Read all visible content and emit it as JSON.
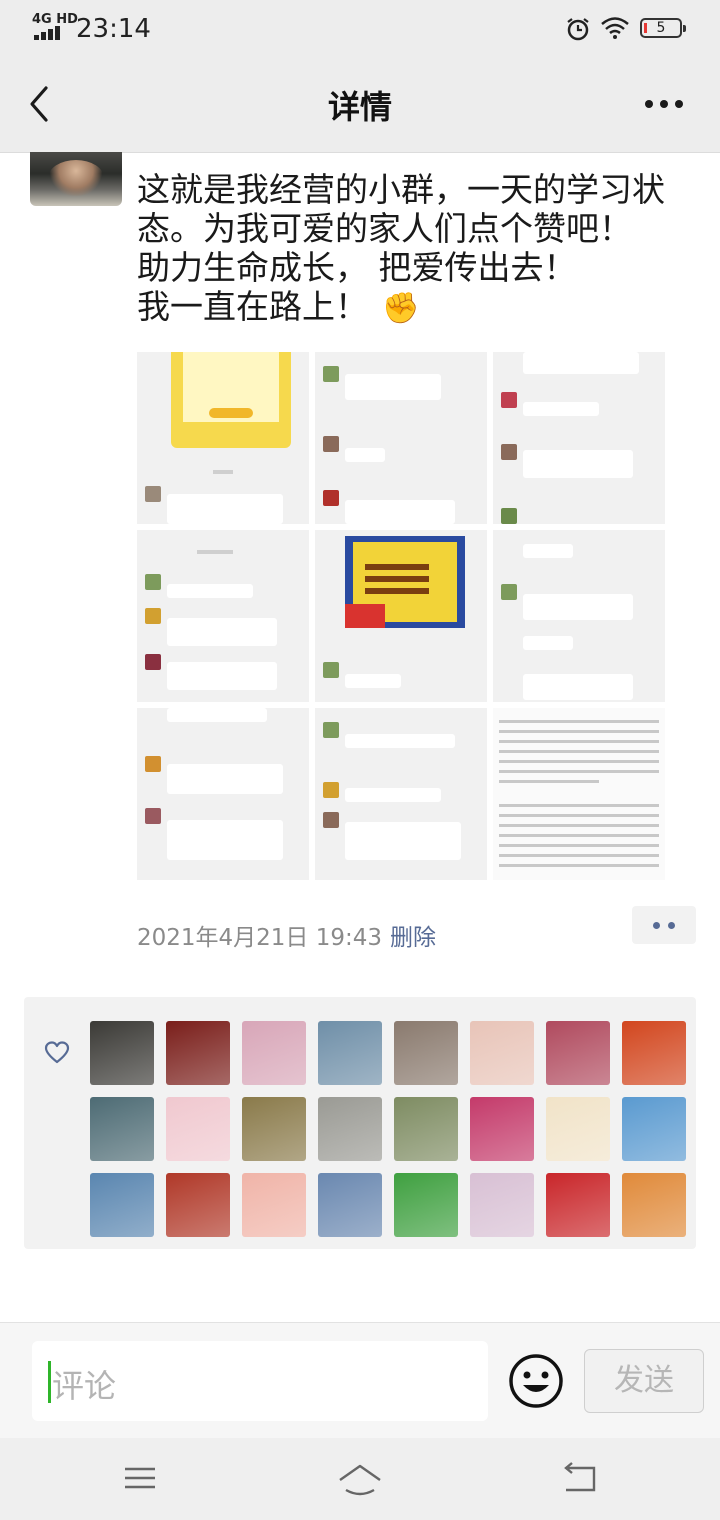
{
  "status_bar": {
    "network": "4G HD",
    "time": "23:14",
    "battery": "5",
    "icons": [
      "signal-icon",
      "alarm-icon",
      "wifi-icon",
      "battery-icon"
    ]
  },
  "nav": {
    "title": "详情",
    "back_icon": "chevron-left-icon",
    "more_icon": "more-horizontal-icon"
  },
  "post": {
    "text_lines": [
      "这就是我经营的小群，一天的学习状",
      "态。为我可爱的家人们点个赞吧！",
      "助力生命成长，  把爱传出去！",
      "我一直在路上！"
    ],
    "emoji": "✊",
    "time": "2021年4月21日 19:43",
    "delete_label": "删除"
  },
  "likes": {
    "icon": "heart-icon",
    "avatar_colors": [
      "#3b3a36",
      "#7a1e1a",
      "#d8a6b8",
      "#6f8fa8",
      "#8a7a6e",
      "#e8c4b8",
      "#b04a5e",
      "#d2461e",
      "#4d6b74",
      "#f0c8cf",
      "#8a7a4a",
      "#9a9a94",
      "#7e8c62",
      "#c43a6a",
      "#f1e3c8",
      "#5a9ad0",
      "#5a86b0",
      "#b03828",
      "#f0b4a8",
      "#6a88b0",
      "#3fa040",
      "#d8c0d4",
      "#c9262a",
      "#e08a3a"
    ]
  },
  "comment": {
    "placeholder": "评论",
    "send_label": "发送",
    "emoji_icon": "smiley-face-icon"
  },
  "system_nav": {
    "icons": [
      "menu-icon",
      "home-icon",
      "back-return-icon"
    ]
  }
}
